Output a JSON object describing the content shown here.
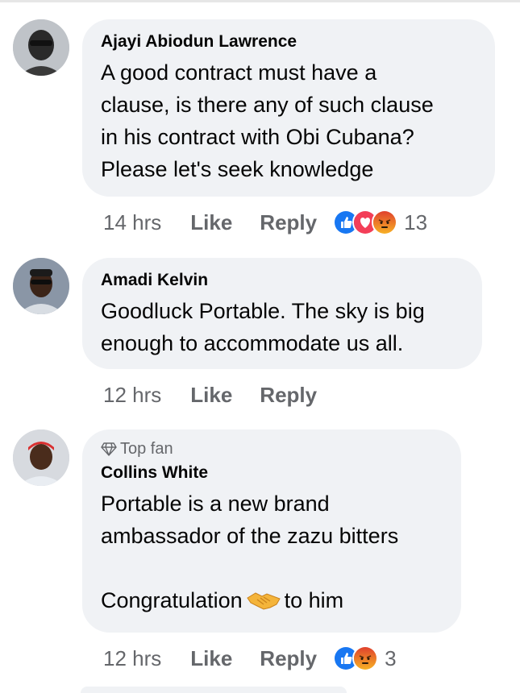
{
  "comments": [
    {
      "author": "Ajayi Abiodun Lawrence",
      "text": "A good contract must have a\nclause, is there any of such clause\nin his contract with Obi Cubana?\nPlease let's seek knowledge",
      "time": "14 hrs",
      "like_label": "Like",
      "reply_label": "Reply",
      "reactions": [
        "like-icon",
        "love-icon",
        "angry-icon"
      ],
      "reaction_count": "13"
    },
    {
      "author": "Amadi Kelvin",
      "text": "Goodluck Portable. The sky is big\nenough to accommodate us all.",
      "time": "12 hrs",
      "like_label": "Like",
      "reply_label": "Reply"
    },
    {
      "badge": "Top fan",
      "author": "Collins White",
      "text_before": "Portable is a new brand\nambassador of the zazu bitters\n\nCongratulation",
      "text_after": "to him",
      "emoji": "handshake-emoji",
      "time": "12 hrs",
      "like_label": "Like",
      "reply_label": "Reply",
      "reactions": [
        "like-icon",
        "angry-icon"
      ],
      "reaction_count": "3"
    }
  ],
  "colors": {
    "bubble": "#f0f2f5",
    "meta_text": "#65676b",
    "like_blue": "#1877f2",
    "love_red": "#f33e58",
    "angry_orange": "#e9710f"
  }
}
